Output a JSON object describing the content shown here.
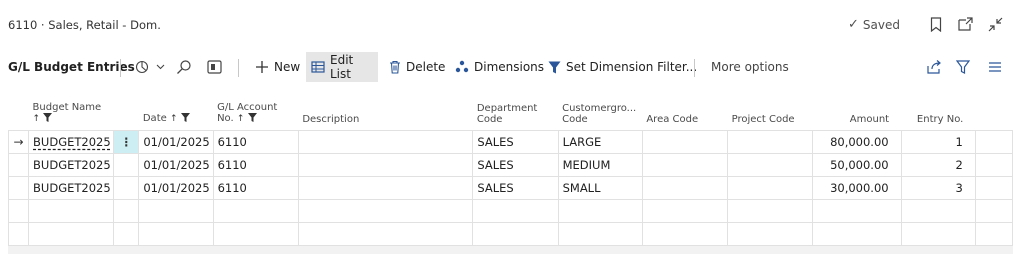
{
  "header": {
    "title": "6110 · Sales, Retail - Dom.",
    "saved_label": "Saved"
  },
  "actionbar": {
    "title": "G/L Budget Entries",
    "new_label": "New",
    "edit_list_label": "Edit List",
    "delete_label": "Delete",
    "dimensions_label": "Dimensions",
    "set_filter_label": "Set Dimension Filter...",
    "more_options_label": "More options"
  },
  "table": {
    "columns": {
      "budget_name": "Budget Name",
      "date": "Date",
      "gl_account_1": "G/L Account",
      "gl_account_2": "No.",
      "description": "Description",
      "department_1": "Department",
      "department_2": "Code",
      "customergroup_1": "Customergro...",
      "customergroup_2": "Code",
      "area_code": "Area Code",
      "project_code": "Project Code",
      "amount": "Amount",
      "entry_no": "Entry No."
    },
    "rows": [
      {
        "budget_name": "BUDGET2025",
        "date": "01/01/2025",
        "gl_account": "6110",
        "description": "",
        "department": "SALES",
        "customergroup": "LARGE",
        "area_code": "",
        "project_code": "",
        "amount": "80,000.00",
        "entry_no": "1"
      },
      {
        "budget_name": "BUDGET2025",
        "date": "01/01/2025",
        "gl_account": "6110",
        "description": "",
        "department": "SALES",
        "customergroup": "MEDIUM",
        "area_code": "",
        "project_code": "",
        "amount": "50,000.00",
        "entry_no": "2"
      },
      {
        "budget_name": "BUDGET2025",
        "date": "01/01/2025",
        "gl_account": "6110",
        "description": "",
        "department": "SALES",
        "customergroup": "SMALL",
        "area_code": "",
        "project_code": "",
        "amount": "30,000.00",
        "entry_no": "3"
      }
    ]
  },
  "colors": {
    "selected_cell": "#cdeef2",
    "active_button": "#e6e6e6",
    "grid_line": "#e1e1e1"
  }
}
